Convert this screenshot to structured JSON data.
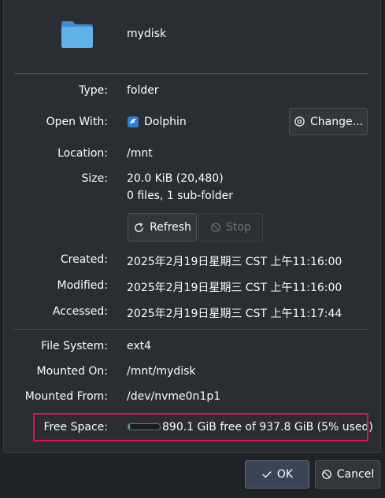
{
  "header": {
    "name": "mydisk",
    "icon": "folder-icon"
  },
  "general": {
    "type_label": "Type:",
    "type_value": "folder",
    "open_with_label": "Open With:",
    "open_with_value": "Dolphin",
    "change_button": "Change...",
    "location_label": "Location:",
    "location_value": "/mnt",
    "size_label": "Size:",
    "size_value": "20.0 KiB (20,480)",
    "contents_value": "0 files, 1 sub-folder",
    "refresh_button": "Refresh",
    "stop_button": "Stop"
  },
  "dates": {
    "created_label": "Created:",
    "created_value": "2025年2月19日星期三 CST 上午11:16:00",
    "modified_label": "Modified:",
    "modified_value": "2025年2月19日星期三 CST 上午11:16:00",
    "accessed_label": "Accessed:",
    "accessed_value": "2025年2月19日星期三 CST 上午11:17:44"
  },
  "filesystem": {
    "fs_label": "File System:",
    "fs_value": "ext4",
    "mounted_on_label": "Mounted On:",
    "mounted_on_value": "/mnt/mydisk",
    "mounted_from_label": "Mounted From:",
    "mounted_from_value": "/dev/nvme0n1p1",
    "free_space_label": "Free Space:",
    "free_space_value": "890.1 GiB free of 937.8 GiB (5% used)",
    "used_fraction": 0.05
  },
  "footer": {
    "ok_button": "OK",
    "cancel_button": "Cancel"
  },
  "colors": {
    "accent": "#3daee9",
    "highlight": "#e0134a",
    "folder": "#5fb1e8"
  }
}
